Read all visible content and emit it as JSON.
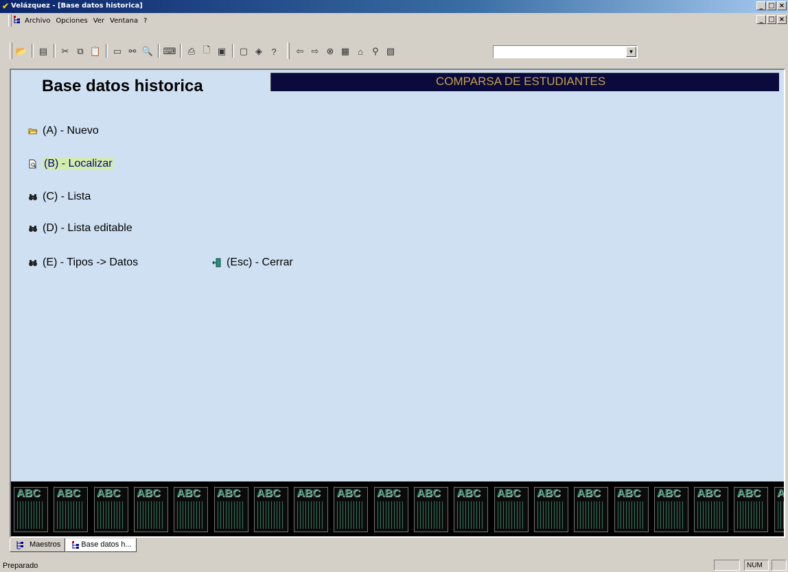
{
  "window": {
    "title": "Velázquez - [Base datos historica]",
    "controls": [
      "_",
      "□",
      "×"
    ]
  },
  "menu": {
    "items": [
      "Archivo",
      "Opciones",
      "Ver",
      "Ventana",
      "?"
    ]
  },
  "toolbar": {
    "combo_value": ""
  },
  "form": {
    "title": "Base datos historica",
    "header": "COMPARSA DE ESTUDIANTES",
    "options": [
      {
        "label": "(A) - Nuevo",
        "icon": "folder-open-icon"
      },
      {
        "label": "(B) - Localizar",
        "icon": "document-search-icon"
      },
      {
        "label": "(C) - Lista",
        "icon": "binoculars-icon"
      },
      {
        "label": "(D) - Lista editable",
        "icon": "binoculars-icon"
      },
      {
        "label": "(E) - Tipos -> Datos",
        "icon": "binoculars-icon"
      },
      {
        "label": "(Esc) - Cerrar",
        "icon": "exit-door-icon"
      }
    ],
    "strip_text": "ABC"
  },
  "tabs": [
    "Maestros",
    "Base datos h..."
  ],
  "status": {
    "text": "Preparado",
    "num": "NUM"
  },
  "colors": {
    "client_bg": "#cfe0f3",
    "header_band": "#0a0a3c",
    "header_text": "#c8a24a",
    "highlight": "#d4ecab"
  }
}
